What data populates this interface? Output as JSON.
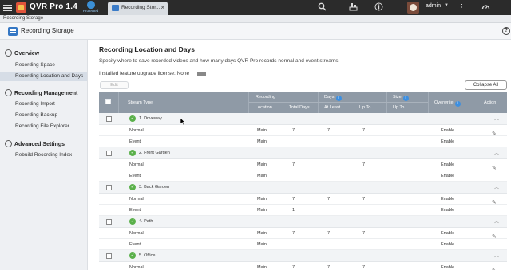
{
  "topbar": {
    "app_title": "QVR Pro 1.4",
    "protected_label": "Protected",
    "tab_label": "Recording Stor...",
    "tab_close": "×",
    "user": "admin",
    "icons": [
      "menu-icon",
      "search-icon",
      "storage-icon",
      "info-icon",
      "more-icon",
      "dashboard-icon"
    ]
  },
  "subtitle": "Recording Storage",
  "app_header": {
    "title": "Recording Storage",
    "help": "?"
  },
  "sidebar": {
    "sections": [
      {
        "label": "Overview",
        "items": [
          "Recording Space",
          "Recording Location and Days"
        ]
      },
      {
        "label": "Recording Management",
        "items": [
          "Recording Import",
          "Recording Backup",
          "Recording File Explorer"
        ]
      },
      {
        "label": "Advanced Settings",
        "items": [
          "Rebuild Recording Index"
        ]
      }
    ],
    "active_item": "Recording Location and Days"
  },
  "main": {
    "title": "Recording Location and Days",
    "description": "Specify where to save recorded videos and how many days QVR Pro records normal and event streams.",
    "license": "Installed feature upgrade license: None",
    "edit_label": "Edit",
    "collapse_label": "Collapse All"
  },
  "table": {
    "headers": {
      "stream_type": "Stream Type",
      "recording": "Recording",
      "location": "Location",
      "total_days": "Total Days",
      "days": "Days",
      "at_least": "At Least",
      "up_to": "Up To",
      "size": "Size",
      "size_up_to": "Up To",
      "overwrite": "Overwrite",
      "action": "Action"
    },
    "groups": [
      {
        "name": "1. Driveway",
        "rows": [
          {
            "type": "Normal",
            "location": "Main",
            "total_days": "7",
            "at_least": "7",
            "up_to": "7",
            "overwrite": "Enable"
          },
          {
            "type": "Event",
            "location": "Main",
            "total_days": "",
            "at_least": "",
            "up_to": "",
            "overwrite": "Enable"
          }
        ]
      },
      {
        "name": "2. Front Garden",
        "rows": [
          {
            "type": "Normal",
            "location": "Main",
            "total_days": "7",
            "at_least": "",
            "up_to": "7",
            "overwrite": "Enable"
          },
          {
            "type": "Event",
            "location": "Main",
            "total_days": "",
            "at_least": "",
            "up_to": "",
            "overwrite": "Enable"
          }
        ]
      },
      {
        "name": "3. Back Garden",
        "rows": [
          {
            "type": "Normal",
            "location": "Main",
            "total_days": "7",
            "at_least": "7",
            "up_to": "7",
            "overwrite": "Enable"
          },
          {
            "type": "Event",
            "location": "Main",
            "total_days": "1",
            "at_least": "",
            "up_to": "",
            "overwrite": "Enable"
          }
        ]
      },
      {
        "name": "4. Path",
        "rows": [
          {
            "type": "Normal",
            "location": "Main",
            "total_days": "7",
            "at_least": "7",
            "up_to": "7",
            "overwrite": "Enable"
          },
          {
            "type": "Event",
            "location": "Main",
            "total_days": "",
            "at_least": "",
            "up_to": "",
            "overwrite": "Enable"
          }
        ]
      },
      {
        "name": "5. Office",
        "rows": [
          {
            "type": "Normal",
            "location": "Main",
            "total_days": "7",
            "at_least": "7",
            "up_to": "7",
            "overwrite": "Enable"
          }
        ]
      }
    ]
  },
  "colors": {
    "topbar_bg": "#2b2b2b",
    "sidebar_bg": "#eef0f3",
    "active_item_bg": "#d6dde6",
    "table_header_bg": "#8f9aa6",
    "ok_green": "#5ab04a",
    "info_blue": "#3d8fe0"
  }
}
